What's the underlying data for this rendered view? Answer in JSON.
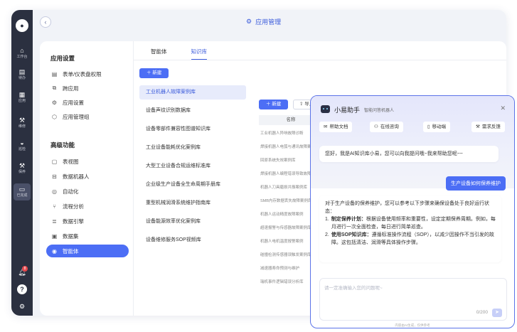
{
  "app": {
    "title": "应用管理",
    "title_icon": "gear-icon"
  },
  "rail": {
    "items": [
      {
        "label": "工作台",
        "icon": "home-icon"
      },
      {
        "label": "待办",
        "icon": "clipboard-icon"
      },
      {
        "label": "应用",
        "icon": "apps-icon"
      },
      {
        "label": "维修",
        "icon": "wrench-icon"
      },
      {
        "label": "巡检",
        "icon": "car-icon"
      },
      {
        "label": "保养",
        "icon": "tool-icon"
      },
      {
        "label": "已完成",
        "icon": "folder-icon"
      }
    ],
    "notification_count": "8"
  },
  "sidebar": {
    "section1": "应用设置",
    "group1": [
      "表单/仪表盘权限",
      "跨应用",
      "应用设置",
      "应用管理组"
    ],
    "section2": "高级功能",
    "group2": [
      "表视图",
      "数据机器人",
      "自动化",
      "流程分析",
      "数据引擎",
      "数据集",
      "智能体"
    ]
  },
  "tabs": [
    "智能体",
    "知识库"
  ],
  "new_label": "＋ 新建",
  "knowledge_bases": [
    "工业机器人故障案例库",
    "设备声纹识别数据库",
    "设备零部件兼容性图谱知识库",
    "工业设备能耗优化案例库",
    "大型工业设备合规运维标准库",
    "企业级生产设备全生命周期手册库",
    "重型机械润滑系统维护指南库",
    "设备能源效率优化案例库",
    "设备维修服务SOP视频库"
  ],
  "table": {
    "new_label": "＋ 新建",
    "import_label": "⇪ 导入",
    "header": "名称",
    "rows": [
      "工业机器人异响故障诊断",
      "焊接机器人电弧与通讯故障案例",
      "回原系统失效案例库",
      "焊接机器人编程错误导致故障",
      "机器人刀具磨损共振案例库",
      "SMB内存数据丢失故障案例库",
      "机器人运动精度故障案例",
      "超速报警与传感器故障案例库",
      "机器人电机温度报警案例",
      "碰撞检测传感器误触发案例库",
      "减速器寿命预测与维护",
      "瑞机事件逻辑错误分析库"
    ]
  },
  "assistant": {
    "title": "小易助手",
    "subtitle": "智能问答机器人",
    "quick_buttons": [
      {
        "label": "帮助文档",
        "icon": "mail-icon"
      },
      {
        "label": "在线咨询",
        "icon": "people-icon"
      },
      {
        "label": "移动端",
        "icon": "phone-icon"
      },
      {
        "label": "需求反馈",
        "icon": "wrench-icon"
      }
    ],
    "greeting": "您好，我是AI知识库小易，您可以向我提问哦~我来帮助您呢~~",
    "user_message": "生产设备如何保养维护",
    "reply_intro": "对于生产设备的保养维护，您可以参考以下步骤来确保设备处于良好运行状态：",
    "reply_items": [
      {
        "n": "1.",
        "head": "制定保养计划：",
        "body": "根据设备使用频率和重要性，设定定期保养周期。例如，每月进行一次全面检查，每日进行简单巡查。"
      },
      {
        "n": "2.",
        "head": "使用SOP知识库：",
        "body": "遵循标准操作流程（SOP），以减少因操作不当引发的故障。这包括清洁、润滑等具体操作步骤。"
      }
    ],
    "input_placeholder": "请一定准确输入您的问题呢~",
    "char_count": "0/200",
    "footer": "内容由AI生成，仅供参考"
  }
}
